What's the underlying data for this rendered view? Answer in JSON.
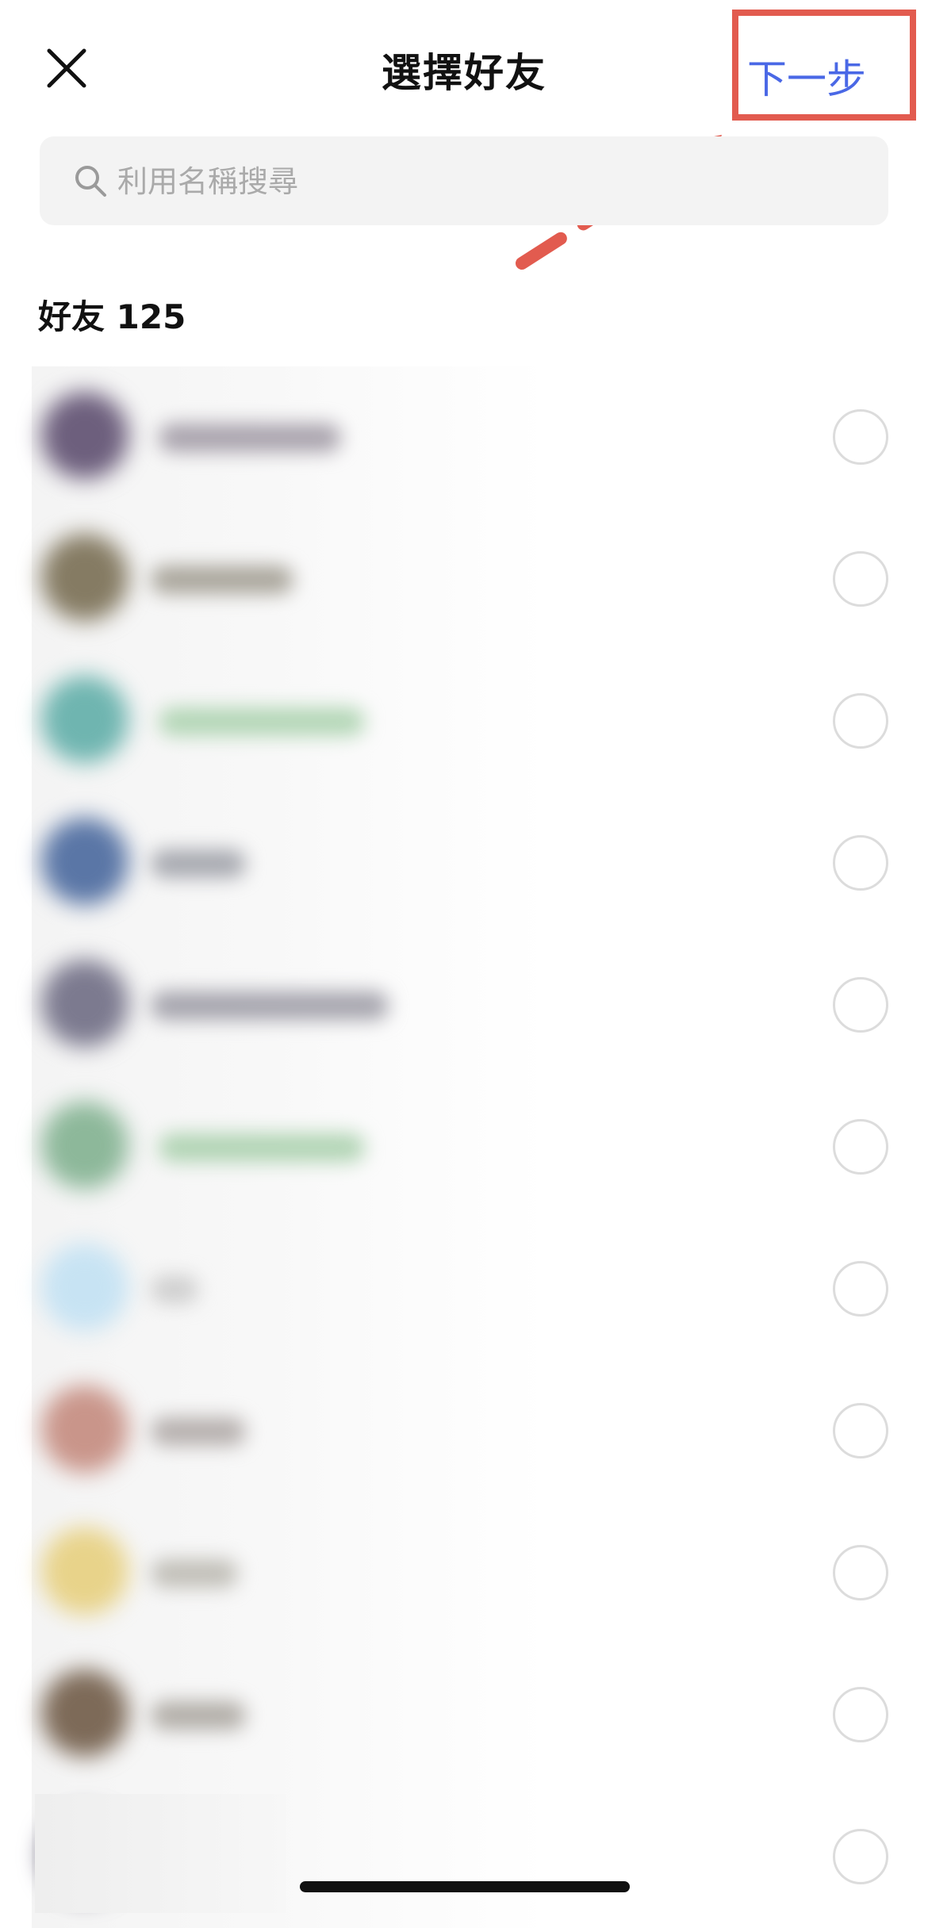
{
  "header": {
    "title": "選擇好友",
    "next_label": "下一步"
  },
  "search": {
    "placeholder": "利用名稱搜尋"
  },
  "friends_section": {
    "label": "好友",
    "count": "125"
  },
  "friends": [
    {
      "avatar_color": "#6d5f7d",
      "name_color": "#a9a3ad",
      "name": ""
    },
    {
      "avatar_color": "#857b63",
      "name_color": "#aaa69c",
      "name": ""
    },
    {
      "avatar_color": "#6fb5b0",
      "name_color": "#b3d6b6",
      "name": ""
    },
    {
      "avatar_color": "#5a76a6",
      "name_color": "#a7a9b0",
      "name": ""
    },
    {
      "avatar_color": "#7c7a8f",
      "name_color": "#a5a4ad",
      "name": ""
    },
    {
      "avatar_color": "#8db89a",
      "name_color": "#b1d4b4",
      "name": ""
    },
    {
      "avatar_color": "#c7e3f3",
      "name_color": "#cfcfcf",
      "name": ""
    },
    {
      "avatar_color": "#c9958a",
      "name_color": "#b6b0ae",
      "name": ""
    },
    {
      "avatar_color": "#e8d38a",
      "name_color": "#c1bfb8",
      "name": ""
    },
    {
      "avatar_color": "#7d6a58",
      "name_color": "#b2aea8",
      "name": ""
    },
    {
      "avatar_color": "#5f5a74",
      "name_color": "#c9c9c9",
      "name": ""
    }
  ],
  "colors": {
    "accent": "#4a68e6",
    "annotation": "#e25b4f"
  },
  "icons": {
    "close": "close-icon",
    "search": "search-icon",
    "annotation_arrow": "arrow-icon"
  }
}
